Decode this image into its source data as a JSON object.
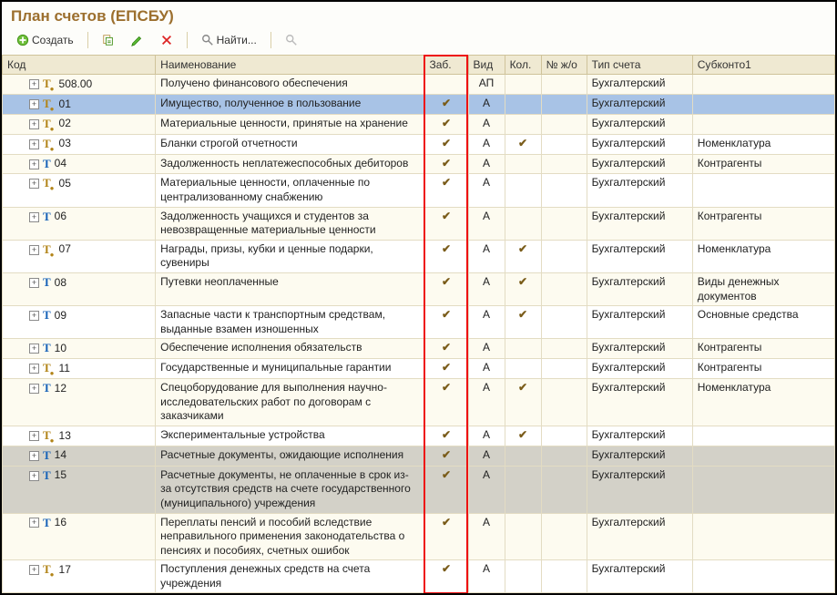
{
  "title": "План счетов (ЕПСБУ)",
  "toolbar": {
    "create": "Создать",
    "find": "Найти..."
  },
  "columns": {
    "kod": "Код",
    "name": "Наименование",
    "zab": "Заб.",
    "vid": "Вид",
    "kol": "Кол.",
    "nzo": "№ ж/о",
    "tip": "Тип счета",
    "sub1": "Субконто1"
  },
  "rows": [
    {
      "kod": "508.00",
      "t": "gold",
      "name": "Получено финансового обеспечения",
      "zab": false,
      "vid": "АП",
      "kol": false,
      "tip": "Бухгалтерский",
      "sub": "",
      "style": "even"
    },
    {
      "kod": "01",
      "t": "gold",
      "name": "Имущество, полученное в пользование",
      "zab": true,
      "vid": "А",
      "kol": false,
      "tip": "Бухгалтерский",
      "sub": "",
      "style": "selected"
    },
    {
      "kod": "02",
      "t": "gold",
      "name": "Материальные ценности, принятые на хранение",
      "zab": true,
      "vid": "А",
      "kol": false,
      "tip": "Бухгалтерский",
      "sub": "",
      "style": "even"
    },
    {
      "kod": "03",
      "t": "gold",
      "name": "Бланки строгой отчетности",
      "zab": true,
      "vid": "А",
      "kol": true,
      "tip": "Бухгалтерский",
      "sub": "Номенклатура",
      "style": "odd"
    },
    {
      "kod": "04",
      "t": "blue",
      "name": "Задолженность неплатежеспособных дебиторов",
      "zab": true,
      "vid": "А",
      "kol": false,
      "tip": "Бухгалтерский",
      "sub": "Контрагенты",
      "style": "even"
    },
    {
      "kod": "05",
      "t": "gold",
      "name": "Материальные ценности, оплаченные по централизованному снабжению",
      "zab": true,
      "vid": "А",
      "kol": false,
      "tip": "Бухгалтерский",
      "sub": "",
      "style": "odd"
    },
    {
      "kod": "06",
      "t": "blue",
      "name": "Задолженность учащихся и студентов за невозвращенные материальные ценности",
      "zab": true,
      "vid": "А",
      "kol": false,
      "tip": "Бухгалтерский",
      "sub": "Контрагенты",
      "style": "even"
    },
    {
      "kod": "07",
      "t": "gold",
      "name": "Награды, призы, кубки и ценные подарки, сувениры",
      "zab": true,
      "vid": "А",
      "kol": true,
      "tip": "Бухгалтерский",
      "sub": "Номенклатура",
      "style": "odd"
    },
    {
      "kod": "08",
      "t": "blue",
      "name": "Путевки неоплаченные",
      "zab": true,
      "vid": "А",
      "kol": true,
      "tip": "Бухгалтерский",
      "sub": "Виды денежных документов",
      "style": "even"
    },
    {
      "kod": "09",
      "t": "blue",
      "name": "Запасные части к транспортным средствам, выданные взамен изношенных",
      "zab": true,
      "vid": "А",
      "kol": true,
      "tip": "Бухгалтерский",
      "sub": "Основные средства",
      "style": "odd"
    },
    {
      "kod": "10",
      "t": "blue",
      "name": "Обеспечение исполнения обязательств",
      "zab": true,
      "vid": "А",
      "kol": false,
      "tip": "Бухгалтерский",
      "sub": "Контрагенты",
      "style": "even"
    },
    {
      "kod": "11",
      "t": "gold",
      "name": "Государственные и муниципальные гарантии",
      "zab": true,
      "vid": "А",
      "kol": false,
      "tip": "Бухгалтерский",
      "sub": "Контрагенты",
      "style": "odd"
    },
    {
      "kod": "12",
      "t": "blue",
      "name": "Спецоборудование для выполнения научно-исследовательских работ по договорам с заказчиками",
      "zab": true,
      "vid": "А",
      "kol": true,
      "tip": "Бухгалтерский",
      "sub": "Номенклатура",
      "style": "even"
    },
    {
      "kod": "13",
      "t": "gold",
      "name": "Экспериментальные устройства",
      "zab": true,
      "vid": "А",
      "kol": true,
      "tip": "Бухгалтерский",
      "sub": "",
      "style": "odd"
    },
    {
      "kod": "14",
      "t": "blue",
      "name": "Расчетные документы, ожидающие исполнения",
      "zab": true,
      "vid": "А",
      "kol": false,
      "tip": "Бухгалтерский",
      "sub": "",
      "style": "shaded"
    },
    {
      "kod": "15",
      "t": "blue",
      "name": "Расчетные документы, не оплаченные в срок из-за отсутствия средств на счете государственного (муниципального) учреждения",
      "zab": true,
      "vid": "А",
      "kol": false,
      "tip": "Бухгалтерский",
      "sub": "",
      "style": "shaded"
    },
    {
      "kod": "16",
      "t": "blue",
      "name": "Переплаты пенсий и пособий вследствие неправильного применения законодательства о пенсиях и пособиях, счетных ошибок",
      "zab": true,
      "vid": "А",
      "kol": false,
      "tip": "Бухгалтерский",
      "sub": "",
      "style": "even"
    },
    {
      "kod": "17",
      "t": "gold",
      "name": "Поступления денежных средств на счета учреждения",
      "zab": true,
      "vid": "А",
      "kol": false,
      "tip": "Бухгалтерский",
      "sub": "",
      "style": "odd"
    }
  ],
  "glyphs": {
    "check": "✔",
    "plus": "+"
  }
}
